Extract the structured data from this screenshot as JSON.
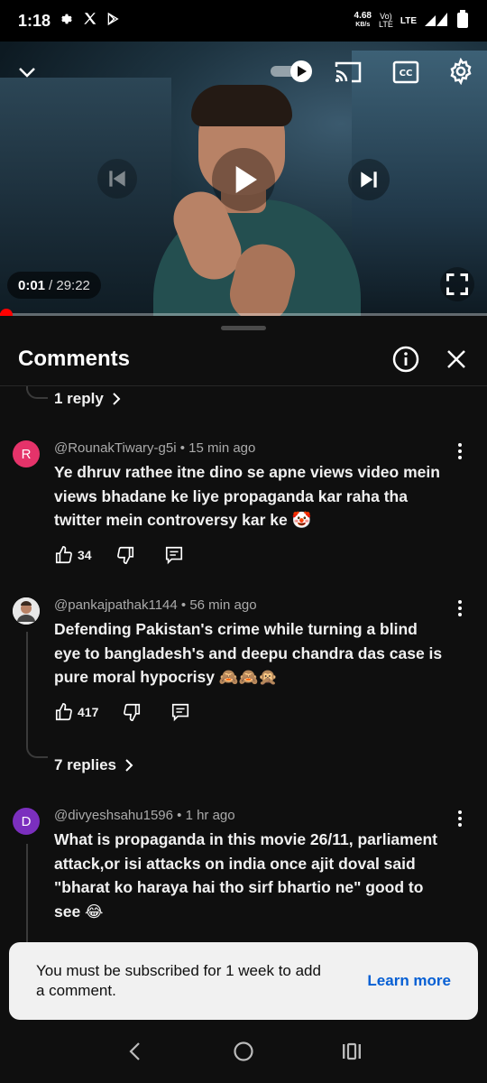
{
  "status_bar": {
    "time": "1:18",
    "net_speed_value": "4.68",
    "net_speed_unit": "KB/s",
    "volte_top": "Vo)",
    "volte_bottom": "LTE",
    "lte": "LTE",
    "icons": [
      "gear-icon",
      "x-logo-icon",
      "play-store-icon",
      "signal-icon",
      "battery-icon"
    ]
  },
  "player": {
    "current_time": "0:01",
    "duration": "/ 29:22",
    "progress": 0.0,
    "icons": [
      "chevron-down-icon",
      "autoplay-toggle-icon",
      "cast-icon",
      "cc-icon",
      "settings-icon",
      "previous-icon",
      "play-icon",
      "next-icon",
      "fullscreen-icon"
    ]
  },
  "comments_panel": {
    "title": "Comments",
    "top_replies_link": "1 reply",
    "comments": [
      {
        "avatar_letter": "R",
        "avatar_color": "#e5336a",
        "handle": "@RounakTiwary-g5i",
        "time": "• 15 min ago",
        "text_lines": [
          "Ye dhruv rathee itne dino se apne views video mein",
          "views bhadane ke liye propaganda kar raha tha",
          "twitter mein controversy kar ke 🤡"
        ],
        "likes": "34"
      },
      {
        "avatar_letter": "",
        "avatar_color": "#ffffff",
        "handle": "@pankajpathak1144",
        "time": "• 56 min ago",
        "text_lines": [
          "Defending Pakistan's crime while turning a blind",
          "eye to bangladesh's and deepu chandra das case  is",
          "pure moral hypocrisy 🙈🙈🙊"
        ],
        "likes": "417",
        "replies_link": "7 replies"
      },
      {
        "avatar_letter": "D",
        "avatar_color": "#7b2fbe",
        "handle": "@divyeshsahu1596",
        "time": "• 1 hr ago",
        "text_lines": [
          "What is propaganda in this movie 26/11, parliament",
          "attack,or isi attacks on india once ajit doval said",
          "\"bharat ko haraya hai tho sirf bhartio ne\" good to",
          "see 😂"
        ],
        "likes": ""
      }
    ]
  },
  "toast": {
    "message": "You must be subscribed for 1 week to add a comment.",
    "action": "Learn more"
  },
  "nav_bar": {
    "icons": [
      "back-icon",
      "home-icon",
      "recents-icon"
    ]
  }
}
